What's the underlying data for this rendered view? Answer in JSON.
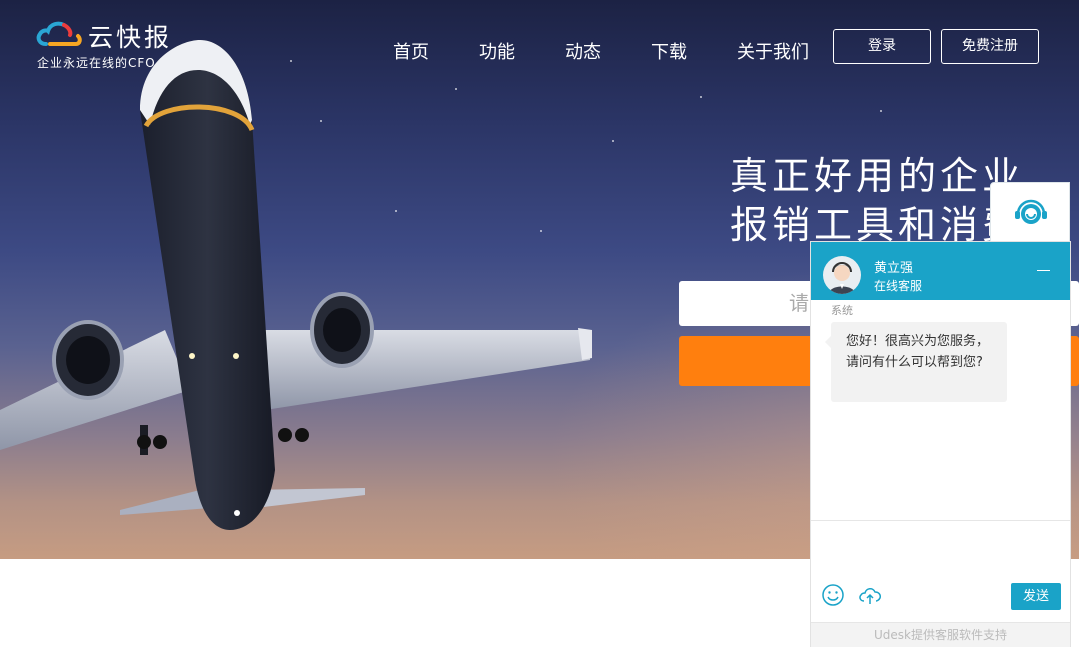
{
  "brand": {
    "name": "云快报",
    "slogan": "企业永远在线的CFO"
  },
  "nav": {
    "items": [
      {
        "label": "首页"
      },
      {
        "label": "功能"
      },
      {
        "label": "动态"
      },
      {
        "label": "下载"
      },
      {
        "label": "关于我们"
      }
    ],
    "login_label": "登录",
    "register_label": "免费注册"
  },
  "hero": {
    "headline_line1": "真正好用的企业",
    "headline_line2": "报销工具和消费",
    "input_placeholder_visible": "请"
  },
  "chat": {
    "agent_name": "黄立强",
    "agent_status": "在线客服",
    "system_label": "系统",
    "welcome_message": "您好！很高兴为您服务，请问有什么可以帮到您?",
    "send_label": "发送",
    "footer": "Udesk提供客服软件支持"
  },
  "colors": {
    "accent": "#1aa3c8",
    "cta": "#ff7f0e"
  },
  "icons": {
    "logo": "cloud-logo-icon",
    "float_service": "customer-service-icon",
    "emoji": "smiley-icon",
    "upload": "cloud-upload-icon",
    "minimize": "minimize-icon"
  }
}
